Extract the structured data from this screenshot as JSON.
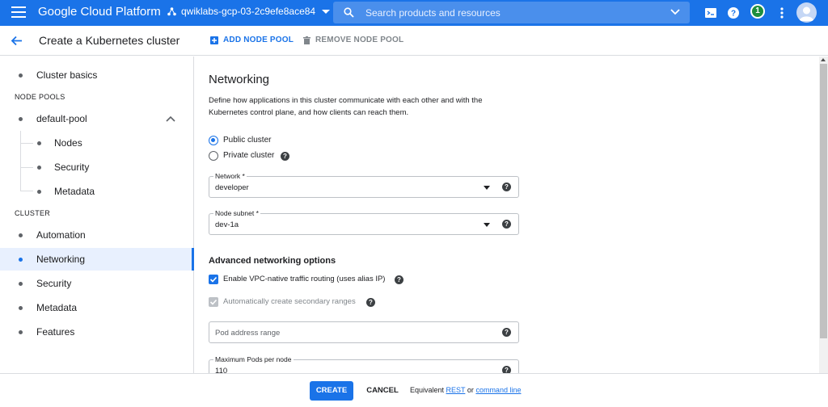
{
  "topbar": {
    "brand": "Google Cloud Platform",
    "project": "qwiklabs-gcp-03-2c9efe8ace84",
    "search_placeholder": "Search products and resources",
    "notification_count": "1",
    "color": "#1a73e8"
  },
  "header": {
    "title": "Create a Kubernetes cluster",
    "add_node_pool": "ADD NODE POOL",
    "remove_node_pool": "REMOVE NODE POOL"
  },
  "sidebar": {
    "cluster_basics": "Cluster basics",
    "node_pools_heading": "NODE POOLS",
    "default_pool": "default-pool",
    "pool_items": [
      "Nodes",
      "Security",
      "Metadata"
    ],
    "cluster_heading": "CLUSTER",
    "cluster_items": [
      "Automation",
      "Networking",
      "Security",
      "Metadata",
      "Features"
    ],
    "active_item": "Networking"
  },
  "networking": {
    "title": "Networking",
    "description": "Define how applications in this cluster communicate with each other and with the Kubernetes control plane, and how clients can reach them.",
    "public_cluster": "Public cluster",
    "private_cluster": "Private cluster",
    "selected_access": "Public cluster",
    "network_label": "Network *",
    "network_value": "developer",
    "subnet_label": "Node subnet *",
    "subnet_value": "dev-1a",
    "advanced_title": "Advanced networking options",
    "vpc_native_label": "Enable VPC-native traffic routing (uses alias IP)",
    "vpc_native_checked": true,
    "secondary_ranges_label": "Automatically create secondary ranges",
    "secondary_ranges_checked": true,
    "pod_range_placeholder": "Pod address range",
    "max_pods_label": "Maximum Pods per node",
    "max_pods_value": "110"
  },
  "footer": {
    "create": "CREATE",
    "cancel": "CANCEL",
    "equivalent": "Equivalent",
    "rest": "REST",
    "or": "or",
    "command_line": "command line"
  }
}
